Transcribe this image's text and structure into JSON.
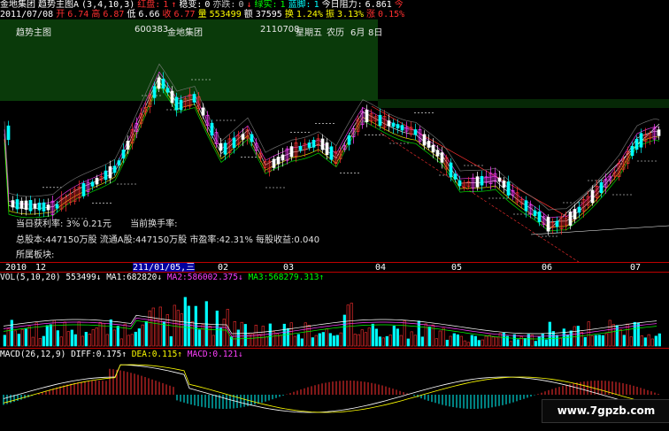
{
  "header": {
    "stock_name": "金地集团",
    "indicator": "趋势主图A",
    "indicator_params": "(3,4,10,3)",
    "hongpan_label": "红盘:",
    "hongpan_value": "1",
    "biandong_label": "稳变:",
    "biandong_value": "0",
    "dieting_label": "亦跌:",
    "dieting_value": "0",
    "lvshi_label": "绿实:",
    "lvshi_value": "1",
    "lanpan_label": "蓝脚:",
    "lanpan_value": "1",
    "zuli_label": "今日阻力:",
    "zuli_value": "6.861",
    "arrow_up": "↑",
    "arrow_down": "↓",
    "extra": "今"
  },
  "quote": {
    "date": "2011/07/08",
    "open_label": "开",
    "open": "6.74",
    "high_label": "高",
    "high": "6.87",
    "low_label": "低",
    "low": "6.66",
    "close_label": "收",
    "close": "6.77",
    "volume_label": "量",
    "volume": "553499",
    "amount_label": "额",
    "amount": "37595",
    "turnover_label": "换",
    "turnover": "1.24%",
    "amplitude_label": "振",
    "amplitude": "3.13%",
    "change_label": "涨",
    "change": "0.15%"
  },
  "subheader": {
    "title": "趋势主图",
    "code": "600383",
    "name": "金地集团",
    "date": "2110708",
    "weekday": "星期五",
    "lunar": "农历",
    "lunar_month": "6月",
    "lunar_day": "8日"
  },
  "info_overlay": {
    "line1_label": "当日获利率:",
    "line1_value": "3%",
    "line1_price": "0.21元",
    "line1_label2": "当前换手率:",
    "line2_label": "总股本:",
    "line2_value": "447150万股",
    "line2_label2": "流通A股:",
    "line2_value2": "447150万股",
    "line2_label3": "市盈率:",
    "line2_value3": "42.31%",
    "line2_label4": "每股收益:",
    "line2_value4": "0.040",
    "line3_label": "所属板块:"
  },
  "date_axis": {
    "labels": [
      "2010",
      "12",
      "211/01/05,三",
      "02",
      "03",
      "04",
      "05",
      "06",
      "07"
    ]
  },
  "volume_header": {
    "name": "VOL",
    "params": "(5,10,20)",
    "vol": "553499",
    "ma1_label": "MA1:",
    "ma1": "682820",
    "ma2_label": "MA2:",
    "ma2": "586002.375",
    "ma3_label": "MA3:",
    "ma3": "568279.313"
  },
  "macd_header": {
    "name": "MACD",
    "params": "(26,12,9)",
    "diff_label": "DIFF:",
    "diff": "0.175",
    "dea_label": "DEA:",
    "dea": "0.115",
    "macd_label": "MACD:",
    "macd": "0.121"
  },
  "watermark": "www.7gpzb.com",
  "colors": {
    "up": "#ff3030",
    "down": "#00ffff",
    "magenta": "#ff40ff",
    "yellow": "#ffff00",
    "green_band": "#0a3a0a"
  }
}
